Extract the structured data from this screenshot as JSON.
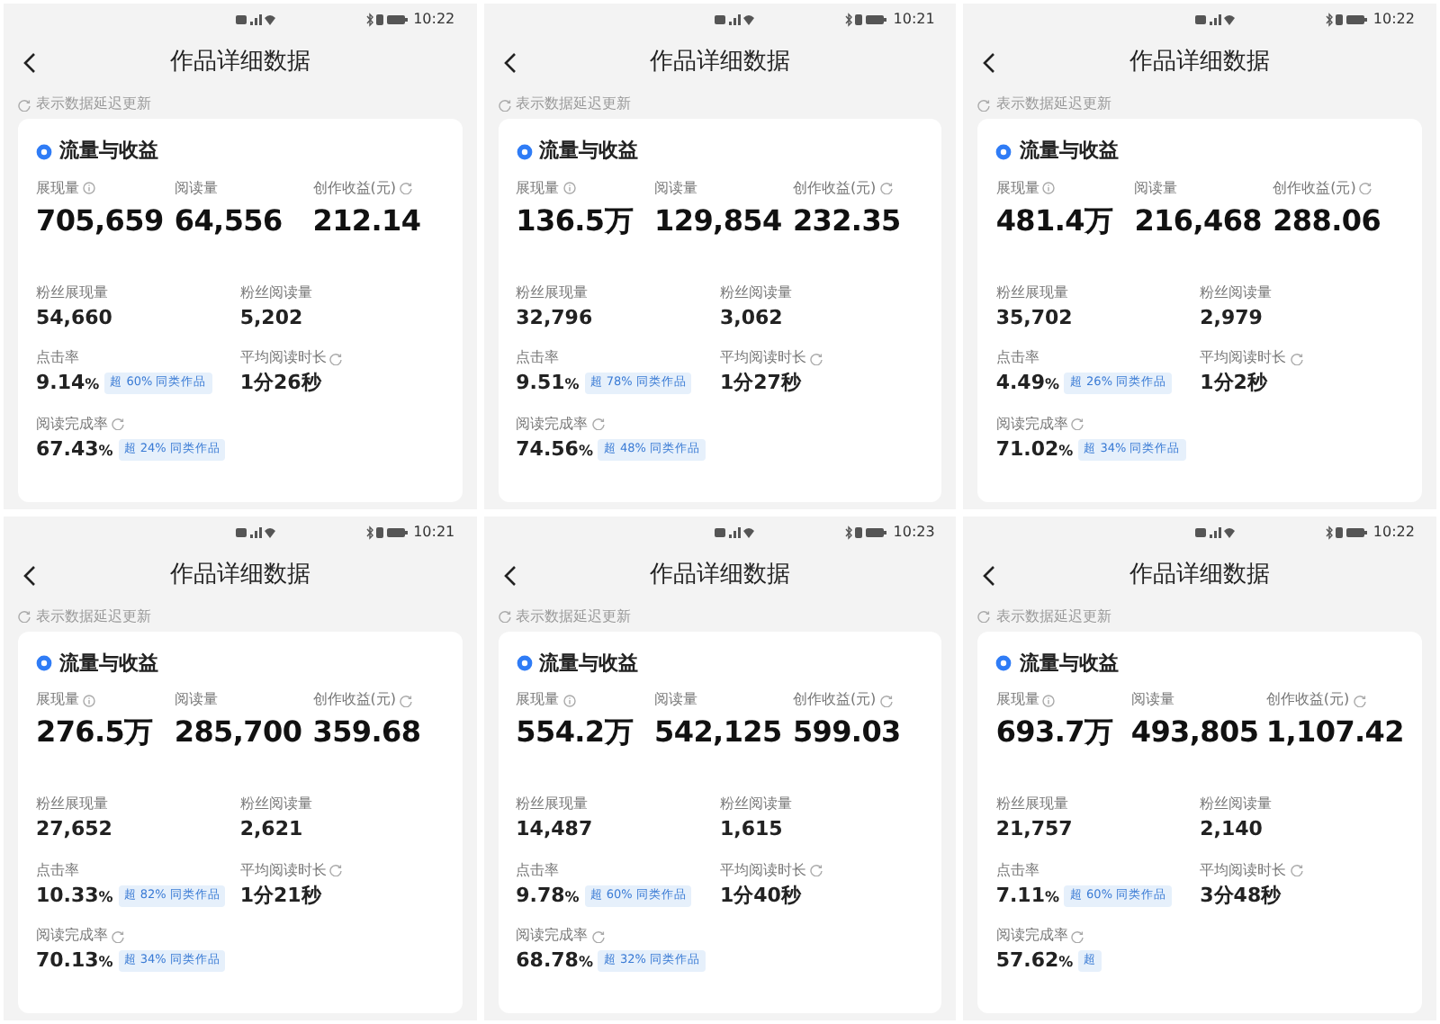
{
  "screens": [
    {
      "time": "10:22",
      "title": "作品详细数据",
      "note": "表示数据延迟更新",
      "card_title": "流量与收益",
      "main": [
        {
          "label": "展现量",
          "kind": "info",
          "value": "705,659"
        },
        {
          "label": "阅读量",
          "kind": "plain",
          "value": "64,556"
        },
        {
          "label": "创作收益(元)",
          "kind": "refresh",
          "value": "212.14"
        }
      ],
      "stats": [
        {
          "label": "粉丝展现量",
          "kind": "plain",
          "value": "54,660"
        },
        {
          "label": "粉丝阅读量",
          "kind": "plain",
          "value": "5,202"
        },
        {
          "label": "点击率",
          "kind": "plain",
          "value": "9.14",
          "unit": "%",
          "badge": "超 60% 同类作品"
        },
        {
          "label": "平均阅读时长",
          "kind": "refresh",
          "value": "1分26秒"
        },
        {
          "label": "阅读完成率",
          "kind": "refresh",
          "value": "67.43",
          "unit": "%",
          "badge": "超 24% 同类作品"
        }
      ]
    },
    {
      "time": "10:21",
      "title": "作品详细数据",
      "note": "表示数据延迟更新",
      "card_title": "流量与收益",
      "main": [
        {
          "label": "展现量",
          "kind": "info",
          "value": "136.5万"
        },
        {
          "label": "阅读量",
          "kind": "plain",
          "value": "129,854"
        },
        {
          "label": "创作收益(元)",
          "kind": "refresh",
          "value": "232.35"
        }
      ],
      "stats": [
        {
          "label": "粉丝展现量",
          "kind": "plain",
          "value": "32,796"
        },
        {
          "label": "粉丝阅读量",
          "kind": "plain",
          "value": "3,062"
        },
        {
          "label": "点击率",
          "kind": "plain",
          "value": "9.51",
          "unit": "%",
          "badge": "超 78% 同类作品"
        },
        {
          "label": "平均阅读时长",
          "kind": "refresh",
          "value": "1分27秒"
        },
        {
          "label": "阅读完成率",
          "kind": "refresh",
          "value": "74.56",
          "unit": "%",
          "badge": "超 48% 同类作品"
        }
      ]
    },
    {
      "time": "10:22",
      "title": "作品详细数据",
      "note": "表示数据延迟更新",
      "card_title": "流量与收益",
      "main": [
        {
          "label": "展现量",
          "kind": "info",
          "value": "481.4万"
        },
        {
          "label": "阅读量",
          "kind": "plain",
          "value": "216,468"
        },
        {
          "label": "创作收益(元)",
          "kind": "refresh",
          "value": "288.06"
        }
      ],
      "stats": [
        {
          "label": "粉丝展现量",
          "kind": "plain",
          "value": "35,702"
        },
        {
          "label": "粉丝阅读量",
          "kind": "plain",
          "value": "2,979"
        },
        {
          "label": "点击率",
          "kind": "plain",
          "value": "4.49",
          "unit": "%",
          "badge": "超 26% 同类作品"
        },
        {
          "label": "平均阅读时长",
          "kind": "refresh",
          "value": "1分2秒"
        },
        {
          "label": "阅读完成率",
          "kind": "refresh",
          "value": "71.02",
          "unit": "%",
          "badge": "超 34% 同类作品"
        }
      ]
    },
    {
      "time": "10:21",
      "title": "作品详细数据",
      "note": "表示数据延迟更新",
      "card_title": "流量与收益",
      "main": [
        {
          "label": "展现量",
          "kind": "info",
          "value": "276.5万"
        },
        {
          "label": "阅读量",
          "kind": "plain",
          "value": "285,700"
        },
        {
          "label": "创作收益(元)",
          "kind": "refresh",
          "value": "359.68"
        }
      ],
      "stats": [
        {
          "label": "粉丝展现量",
          "kind": "plain",
          "value": "27,652"
        },
        {
          "label": "粉丝阅读量",
          "kind": "plain",
          "value": "2,621"
        },
        {
          "label": "点击率",
          "kind": "plain",
          "value": "10.33",
          "unit": "%",
          "badge": "超 82% 同类作品"
        },
        {
          "label": "平均阅读时长",
          "kind": "refresh",
          "value": "1分21秒"
        },
        {
          "label": "阅读完成率",
          "kind": "refresh",
          "value": "70.13",
          "unit": "%",
          "badge": "超 34% 同类作品"
        }
      ]
    },
    {
      "time": "10:23",
      "title": "作品详细数据",
      "note": "表示数据延迟更新",
      "card_title": "流量与收益",
      "main": [
        {
          "label": "展现量",
          "kind": "info",
          "value": "554.2万"
        },
        {
          "label": "阅读量",
          "kind": "plain",
          "value": "542,125"
        },
        {
          "label": "创作收益(元)",
          "kind": "refresh",
          "value": "599.03"
        }
      ],
      "stats": [
        {
          "label": "粉丝展现量",
          "kind": "plain",
          "value": "14,487"
        },
        {
          "label": "粉丝阅读量",
          "kind": "plain",
          "value": "1,615"
        },
        {
          "label": "点击率",
          "kind": "plain",
          "value": "9.78",
          "unit": "%",
          "badge": "超 60% 同类作品"
        },
        {
          "label": "平均阅读时长",
          "kind": "refresh",
          "value": "1分40秒"
        },
        {
          "label": "阅读完成率",
          "kind": "refresh",
          "value": "68.78",
          "unit": "%",
          "badge": "超 32% 同类作品"
        }
      ]
    },
    {
      "time": "10:22",
      "title": "作品详细数据",
      "note": "表示数据延迟更新",
      "card_title": "流量与收益",
      "main": [
        {
          "label": "展现量",
          "kind": "info",
          "value": "693.7万"
        },
        {
          "label": "阅读量",
          "kind": "plain",
          "value": "493,805"
        },
        {
          "label": "创作收益(元)",
          "kind": "refresh",
          "value": "1,107.42"
        }
      ],
      "stats": [
        {
          "label": "粉丝展现量",
          "kind": "plain",
          "value": "21,757"
        },
        {
          "label": "粉丝阅读量",
          "kind": "plain",
          "value": "2,140"
        },
        {
          "label": "点击率",
          "kind": "plain",
          "value": "7.11",
          "unit": "%",
          "badge": "超 60% 同类作品"
        },
        {
          "label": "平均阅读时长",
          "kind": "refresh",
          "value": "3分48秒"
        },
        {
          "label": "阅读完成率",
          "kind": "refresh",
          "value": "57.62",
          "unit": "%",
          "badge": "超"
        }
      ]
    }
  ]
}
